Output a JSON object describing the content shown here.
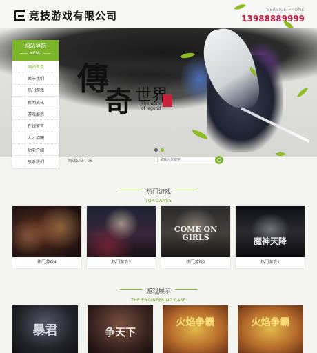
{
  "header": {
    "company_name": "竞技游戏有限公司",
    "phone_label": "SERVICE PHONE",
    "phone": "13988889999"
  },
  "banner": {
    "title_char1": "傳",
    "title_char2": "奇",
    "title_char3": "世界",
    "subtitle_en": "The world of legend",
    "slides": 2,
    "active_slide": 2
  },
  "sidebar": {
    "title": "网站导航",
    "subtitle": "MENU",
    "items": [
      {
        "label": "网站首页",
        "active": true
      },
      {
        "label": "关于我们",
        "active": false
      },
      {
        "label": "热门游戏",
        "active": false
      },
      {
        "label": "新闻资讯",
        "active": false
      },
      {
        "label": "游戏展示",
        "active": false
      },
      {
        "label": "在线留言",
        "active": false
      },
      {
        "label": "人才招聘",
        "active": false
      },
      {
        "label": "功能介绍",
        "active": false
      },
      {
        "label": "联系我们",
        "active": false
      }
    ]
  },
  "notice": {
    "label": "网站公告：",
    "text": "朱"
  },
  "search": {
    "placeholder": "请输入关键字"
  },
  "hot_games": {
    "title": "热门游戏",
    "subtitle": "TOP GAMES",
    "items": [
      {
        "label": "热门游戏4",
        "art_text": ""
      },
      {
        "label": "热门游戏3",
        "art_text": ""
      },
      {
        "label": "热门游戏2",
        "art_text": "COME ON GIRLS"
      },
      {
        "label": "热门游戏1",
        "art_text": "魔神天降"
      }
    ]
  },
  "showcase": {
    "title": "游戏展示",
    "subtitle": "THE ENGINEERING CASE",
    "items": [
      {
        "art_text": "暴君"
      },
      {
        "art_text": "争天下"
      },
      {
        "art_text": "火焰争霸"
      },
      {
        "art_text": "火焰争霸"
      }
    ]
  },
  "colors": {
    "accent": "#7bb52a",
    "phone": "#c21f4a"
  }
}
